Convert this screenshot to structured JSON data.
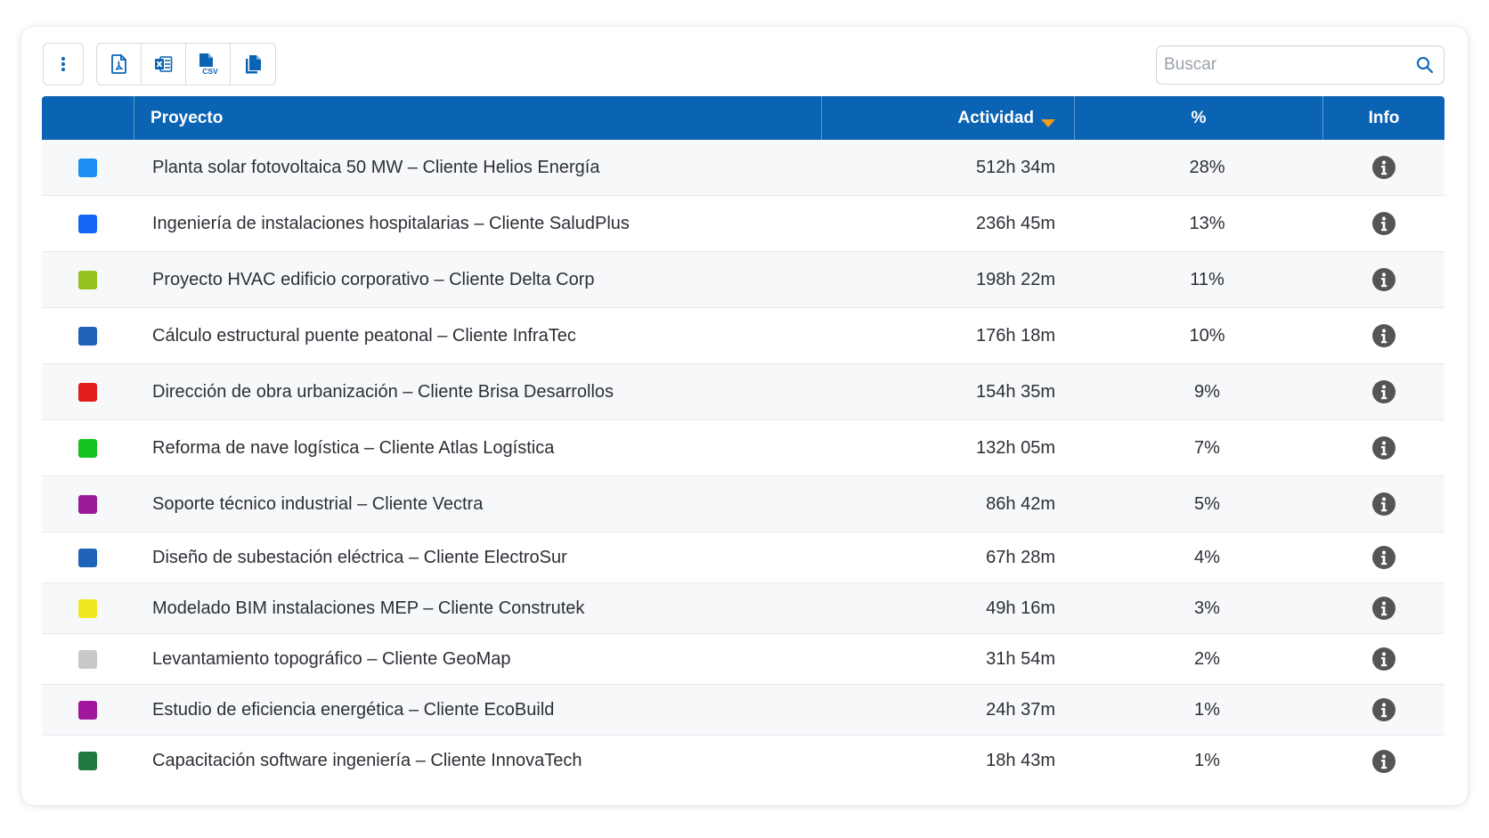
{
  "toolbar": {
    "menu_icon": "kebab-menu-icon",
    "export_buttons": [
      {
        "icon": "pdf-file-icon"
      },
      {
        "icon": "excel-file-icon"
      },
      {
        "icon": "csv-file-icon",
        "badge": "CSV"
      },
      {
        "icon": "copy-icon"
      }
    ]
  },
  "search": {
    "placeholder": "Buscar",
    "value": "",
    "icon": "search-icon"
  },
  "table": {
    "columns": {
      "color": "",
      "project": "Proyecto",
      "activity": "Actividad",
      "percent": "%",
      "info": "Info"
    },
    "sort": {
      "column": "activity",
      "direction": "desc",
      "icon": "sort-desc-icon"
    },
    "rows": [
      {
        "color": "#1a8ef2",
        "project": "Planta solar fotovoltaica 50 MW – Cliente Helios Energía",
        "activity": "512h 34m",
        "percent": "28%"
      },
      {
        "color": "#1565f5",
        "project": "Ingeniería de instalaciones hospitalarias – Cliente SaludPlus",
        "activity": "236h 45m",
        "percent": "13%"
      },
      {
        "color": "#94c11c",
        "project": "Proyecto HVAC edificio corporativo – Cliente Delta Corp",
        "activity": "198h 22m",
        "percent": "11%"
      },
      {
        "color": "#1f63b9",
        "project": "Cálculo estructural puente peatonal – Cliente InfraTec",
        "activity": "176h 18m",
        "percent": "10%"
      },
      {
        "color": "#e21b1b",
        "project": "Dirección de obra urbanización – Cliente Brisa Desarrollos",
        "activity": "154h 35m",
        "percent": "9%"
      },
      {
        "color": "#13c21e",
        "project": "Reforma de nave logística – Cliente Atlas Logística",
        "activity": "132h 05m",
        "percent": "7%"
      },
      {
        "color": "#9a1a98",
        "project": "Soporte técnico industrial – Cliente Vectra",
        "activity": "86h 42m",
        "percent": "5%"
      },
      {
        "color": "#1f63b9",
        "project": "Diseño de subestación eléctrica – Cliente ElectroSur",
        "activity": "67h 28m",
        "percent": "4%"
      },
      {
        "color": "#f1e71f",
        "project": "Modelado BIM instalaciones MEP – Cliente Construtek",
        "activity": "49h 16m",
        "percent": "3%"
      },
      {
        "color": "#c8c8c8",
        "project": "Levantamiento topográfico – Cliente GeoMap",
        "activity": "31h 54m",
        "percent": "2%"
      },
      {
        "color": "#a0179d",
        "project": "Estudio de eficiencia energética – Cliente EcoBuild",
        "activity": "24h 37m",
        "percent": "1%"
      },
      {
        "color": "#1f7a3f",
        "project": "Capacitación software ingeniería – Cliente InnovaTech",
        "activity": "18h 43m",
        "percent": "1%"
      }
    ]
  },
  "colors": {
    "header_bg": "#0b63b3",
    "accent": "#0b63b3",
    "sort_arrow": "#f39c1e",
    "info_icon": "#555555"
  }
}
